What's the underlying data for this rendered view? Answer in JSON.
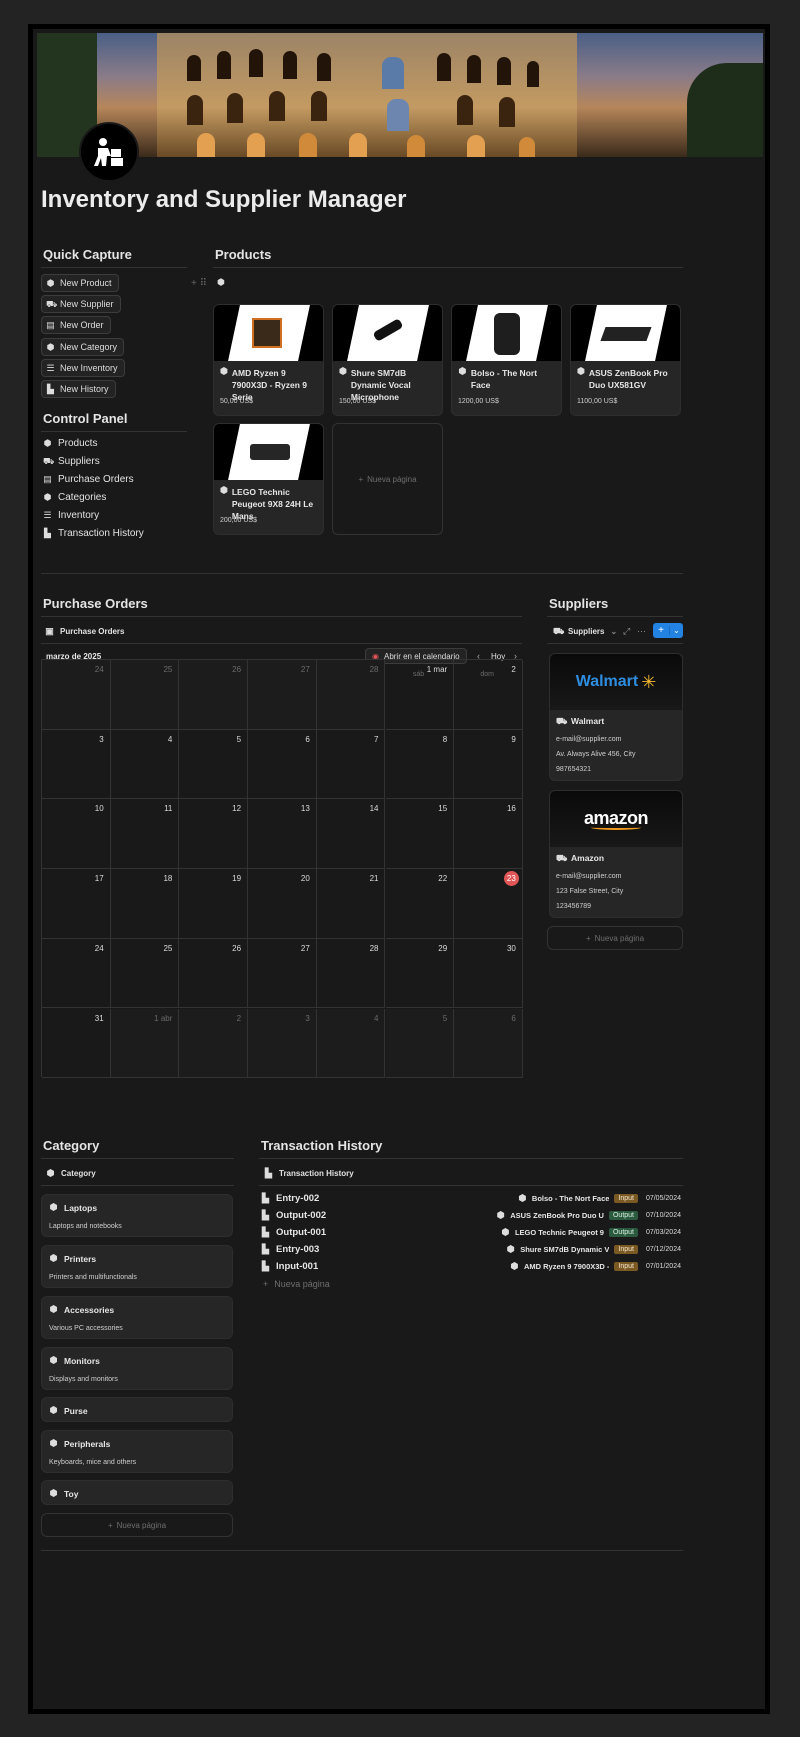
{
  "page": {
    "title": "Inventory and Supplier Manager"
  },
  "quick_capture": {
    "heading": "Quick Capture",
    "buttons": [
      "New Product",
      "New Supplier",
      "New Order",
      "New Category",
      "New Inventory",
      "New History"
    ]
  },
  "control_panel": {
    "heading": "Control Panel",
    "items": [
      "Products",
      "Suppliers",
      "Purchase Orders",
      "Categories",
      "Inventory",
      "Transaction History"
    ]
  },
  "products": {
    "heading": "Products",
    "items": [
      {
        "name": "AMD Ryzen 9 7900X3D - Ryzen 9 Serie",
        "price": "50,00 US$"
      },
      {
        "name": "Shure SM7dB Dynamic Vocal Microphone",
        "price": "150,00 US$"
      },
      {
        "name": "Bolso - The Nort Face",
        "price": "1200,00 US$"
      },
      {
        "name": "ASUS ZenBook Pro Duo UX581GV",
        "price": "1100,00 US$"
      },
      {
        "name": "LEGO Technic Peugeot 9X8 24H Le Mans",
        "price": "200,00 US$"
      }
    ],
    "new_page": "Nueva página"
  },
  "purchase_orders": {
    "heading": "Purchase Orders",
    "view_label": "Purchase Orders",
    "month": "marzo de 2025",
    "open_calendar": "Abrir en el calendario",
    "today_label": "Hoy",
    "weekdays": [
      "lun",
      "mar",
      "mié",
      "jue",
      "vie",
      "sáb",
      "dom"
    ],
    "days": [
      "24",
      "25",
      "26",
      "27",
      "28",
      "1 mar",
      "2",
      "3",
      "4",
      "5",
      "6",
      "7",
      "8",
      "9",
      "10",
      "11",
      "12",
      "13",
      "14",
      "15",
      "16",
      "17",
      "18",
      "19",
      "20",
      "21",
      "22",
      "23",
      "24",
      "25",
      "26",
      "27",
      "28",
      "29",
      "30",
      "31",
      "1 abr",
      "2",
      "3",
      "4",
      "5",
      "6"
    ],
    "today_day": "23"
  },
  "suppliers": {
    "heading": "Suppliers",
    "view_label": "Suppliers",
    "items": [
      {
        "name": "Walmart",
        "logo_text": "Walmart",
        "email": "e-mail@supplier.com",
        "address": "Av. Always Alive 456, City",
        "phone": "987654321"
      },
      {
        "name": "Amazon",
        "logo_text": "amazon",
        "email": "e-mail@supplier.com",
        "address": "123 False Street, City",
        "phone": "123456789"
      }
    ],
    "new_page": "Nueva página"
  },
  "category": {
    "heading": "Category",
    "view_label": "Category",
    "items": [
      {
        "name": "Laptops",
        "desc": "Laptops and notebooks"
      },
      {
        "name": "Printers",
        "desc": "Printers and multifunctionals"
      },
      {
        "name": "Accessories",
        "desc": "Various PC accessories"
      },
      {
        "name": "Monitors",
        "desc": "Displays and monitors"
      },
      {
        "name": "Purse",
        "desc": ""
      },
      {
        "name": "Peripherals",
        "desc": "Keyboards, mice and others"
      },
      {
        "name": "Toy",
        "desc": ""
      }
    ],
    "new_page": "Nueva página"
  },
  "transaction_history": {
    "heading": "Transaction History",
    "view_label": "Transaction History",
    "rows": [
      {
        "id": "Entry-002",
        "product": "Bolso - The Nort Face",
        "type": "Input",
        "date": "07/05/2024"
      },
      {
        "id": "Output-002",
        "product": "ASUS ZenBook Pro Duo U",
        "type": "Output",
        "date": "07/10/2024"
      },
      {
        "id": "Output-001",
        "product": "LEGO Technic Peugeot 9",
        "type": "Output",
        "date": "07/03/2024"
      },
      {
        "id": "Entry-003",
        "product": "Shure SM7dB Dynamic V",
        "type": "Input",
        "date": "07/12/2024"
      },
      {
        "id": "Input-001",
        "product": "AMD Ryzen 9 7900X3D -",
        "type": "Input",
        "date": "07/01/2024"
      }
    ],
    "new_page": "Nueva página"
  },
  "colors": {
    "background": "#191919",
    "accent": "#2383e2",
    "today": "#e05555",
    "input_tag": "#7a5a22",
    "output_tag": "#2c5a3f"
  }
}
